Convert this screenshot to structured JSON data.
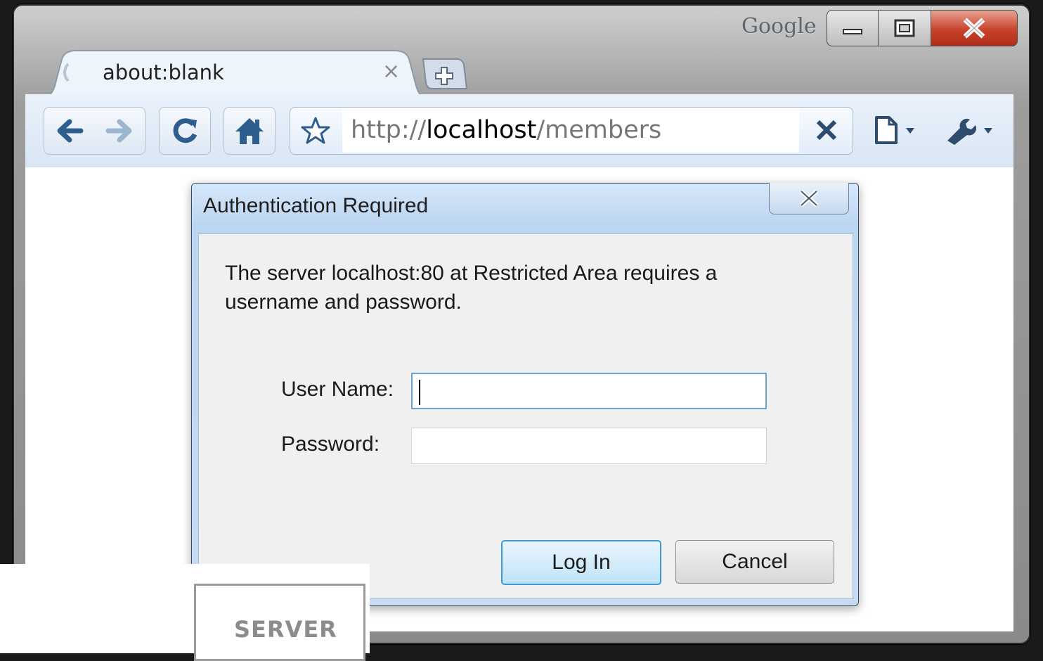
{
  "browser": {
    "brand": "Google",
    "tab": {
      "title": "about:blank",
      "close": "×"
    },
    "url": {
      "scheme": "http://",
      "host": "localhost",
      "path": "/members"
    }
  },
  "dialog": {
    "title": "Authentication Required",
    "message_line1": "The server localhost:80 at Restricted Area requires a",
    "message_line2": "username and password.",
    "username_label": "User Name:",
    "password_label": "Password:",
    "username_value": "",
    "password_value": "",
    "login_label": "Log In",
    "cancel_label": "Cancel"
  },
  "overlay": {
    "server_label": "SERVER"
  },
  "colors": {
    "toolbar": "#e4eef9",
    "close_button": "#c8422b",
    "dialog_frame": "#c7dcf3",
    "login_focus": "#3c9ad6"
  },
  "icons": [
    "minimize-icon",
    "maximize-icon",
    "close-icon",
    "loading-spinner-icon",
    "new-tab-icon",
    "back-arrow-icon",
    "forward-arrow-icon",
    "reload-icon",
    "home-icon",
    "star-icon",
    "stop-icon",
    "page-menu-icon",
    "wrench-icon",
    "dialog-close-icon"
  ]
}
